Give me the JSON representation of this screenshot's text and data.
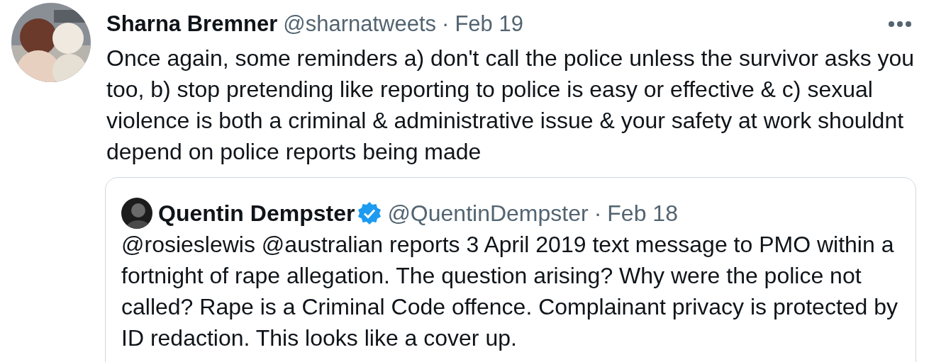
{
  "tweet": {
    "author": {
      "name": "Sharna Bremner",
      "handle": "@sharnatweets",
      "separator": "·",
      "date": "Feb 19"
    },
    "text": "Once again, some reminders a) don't call the police unless the survivor asks you too, b) stop pretending like reporting to police is easy or effective & c) sexual violence is both a criminal & administrative issue & your safety at work shouldnt depend on police reports being made",
    "quoted": {
      "author": {
        "name": "Quentin Dempster",
        "verified": true,
        "handle": "@QuentinDempster",
        "separator": "·",
        "date": "Feb 18"
      },
      "text": "@rosieslewis @australian reports 3 April 2019 text message to PMO within a fortnight of rape allegation. The question arising? Why were the police not called? Rape is a Criminal Code offence. Complainant privacy is protected by ID redaction. This looks like a cover up."
    }
  }
}
